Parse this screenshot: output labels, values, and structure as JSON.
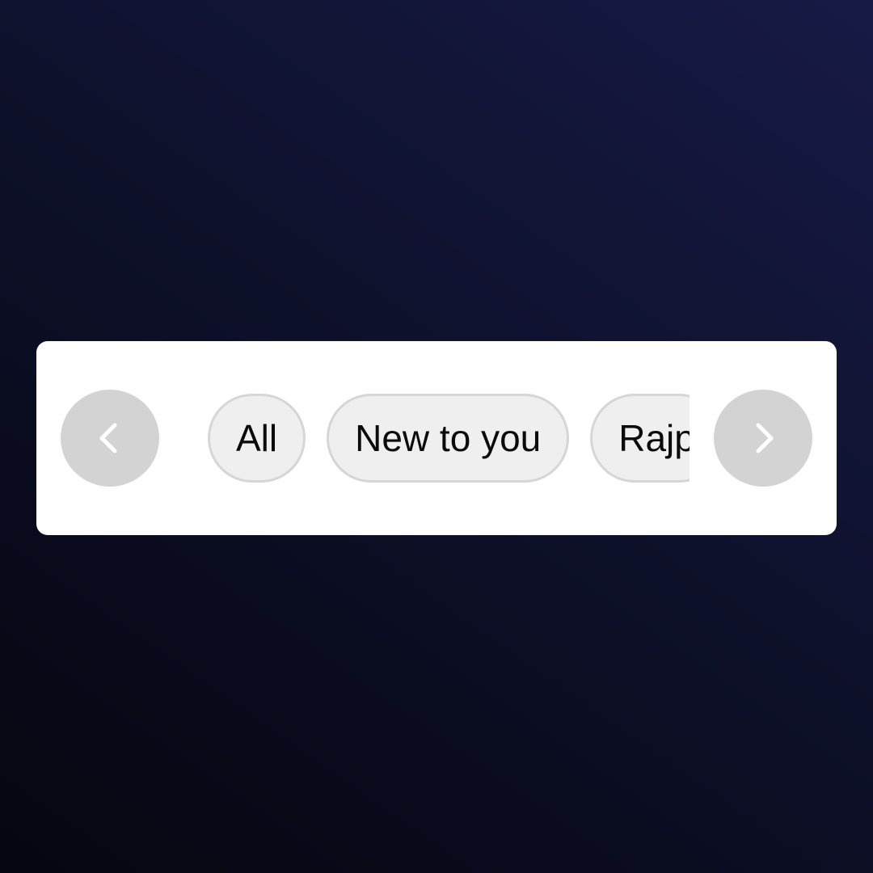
{
  "carousel": {
    "prev_icon": "chevron-left-icon",
    "next_icon": "chevron-right-icon",
    "chips": [
      {
        "label": "All"
      },
      {
        "label": "New to you"
      },
      {
        "label": "Rajp"
      }
    ]
  },
  "colors": {
    "background_start": "#05060f",
    "background_end": "#171a45",
    "card": "#ffffff",
    "nav_button": "#d3d3d3",
    "chip_fill": "#efefef",
    "chip_border": "#d6d6d6",
    "chip_text": "#0b0b0b"
  }
}
